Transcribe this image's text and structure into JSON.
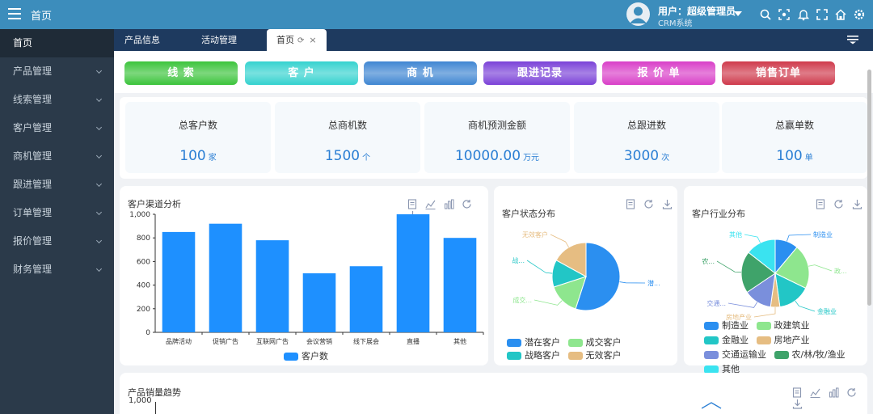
{
  "header": {
    "home_title": "首页",
    "user_label": "用户：超级管理员",
    "system_name": "CRM系统"
  },
  "sidebar": {
    "items": [
      {
        "label": "首页",
        "active": true
      },
      {
        "label": "产品管理"
      },
      {
        "label": "线索管理"
      },
      {
        "label": "客户管理"
      },
      {
        "label": "商机管理"
      },
      {
        "label": "跟进管理"
      },
      {
        "label": "订单管理"
      },
      {
        "label": "报价管理"
      },
      {
        "label": "财务管理"
      }
    ]
  },
  "tabs": {
    "items": [
      "产品信息",
      "活动管理"
    ],
    "active": "首页"
  },
  "quick_buttons": [
    {
      "label": "线 索",
      "color": "#3cc43c"
    },
    {
      "label": "客 户",
      "color": "#35d2cf"
    },
    {
      "label": "商 机",
      "color": "#3f86d2"
    },
    {
      "label": "跟进记录",
      "color": "#7b42d8"
    },
    {
      "label": "报 价 单",
      "color": "#d93fc8"
    },
    {
      "label": "销售订单",
      "color": "#cf3a4c"
    }
  ],
  "stats": [
    {
      "label": "总客户数",
      "value": "100",
      "unit": "家"
    },
    {
      "label": "总商机数",
      "value": "1500",
      "unit": "个"
    },
    {
      "label": "商机预测金额",
      "value": "10000.00",
      "unit": "万元"
    },
    {
      "label": "总跟进数",
      "value": "3000",
      "unit": "次"
    },
    {
      "label": "总赢单数",
      "value": "100",
      "unit": "单"
    }
  ],
  "chart_data": [
    {
      "type": "bar",
      "title": "客户渠道分析",
      "categories": [
        "品牌活动",
        "促销广告",
        "互联网广告",
        "会议营销",
        "线下展会",
        "直播",
        "其他"
      ],
      "series": [
        {
          "name": "客户数",
          "values": [
            850,
            920,
            780,
            500,
            560,
            1000,
            800
          ],
          "color": "#1e90ff"
        }
      ],
      "ylim": [
        0,
        1000
      ],
      "yticks": [
        "1,000",
        "800",
        "600",
        "400",
        "200",
        "0"
      ],
      "legend": "bottom"
    },
    {
      "type": "pie",
      "title": "客户状态分布",
      "slices": [
        {
          "label": "潜在客户",
          "value": 55,
          "color": "#2b8ff0",
          "short": "潜..."
        },
        {
          "label": "成交客户",
          "value": 15,
          "color": "#8ee68e",
          "short": "成交..."
        },
        {
          "label": "战略客户",
          "value": 13,
          "color": "#22c6c6",
          "short": "战..."
        },
        {
          "label": "无效客户",
          "value": 17,
          "color": "#e6bd82",
          "short": "无效客户"
        }
      ],
      "legend": "bottom"
    },
    {
      "type": "pie",
      "title": "客户行业分布",
      "slices": [
        {
          "label": "制造业",
          "value": 10,
          "color": "#2b8ff0",
          "short": "制造业"
        },
        {
          "label": "政建筑业",
          "value": 19,
          "color": "#8ee68e",
          "short": "政..."
        },
        {
          "label": "金融业",
          "value": 14,
          "color": "#22c6c6",
          "short": "金融业"
        },
        {
          "label": "房地产业",
          "value": 4,
          "color": "#e6bd82",
          "short": "房地产业"
        },
        {
          "label": "交通运输业",
          "value": 12,
          "color": "#7a8fdc",
          "short": "交通..."
        },
        {
          "label": "农/林/牧/渔业",
          "value": 18,
          "color": "#3fa36a",
          "short": "农..."
        },
        {
          "label": "其他",
          "value": 13,
          "color": "#3ae3f0",
          "short": "其他"
        }
      ],
      "legend": "bottom"
    },
    {
      "type": "line",
      "title": "产品销量趋势",
      "yticks": [
        "1,000"
      ],
      "ylim": [
        0,
        1000
      ]
    }
  ]
}
